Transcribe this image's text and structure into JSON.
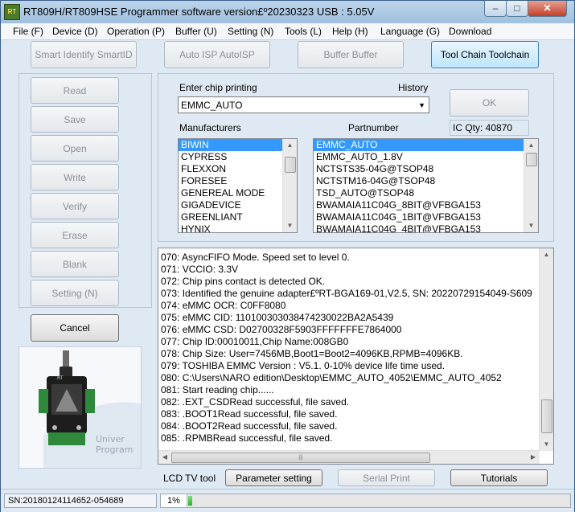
{
  "window": {
    "title": "RT809H/RT809HSE Programmer software version£º20230323  USB : 5.05V",
    "icon_text": "RT",
    "minimize": "–",
    "maximize": "□",
    "close": "✕"
  },
  "menu": [
    "File (F)",
    "Device (D)",
    "Operation (P)",
    "Buffer (U)",
    "Setting (N)",
    "Tools (L)",
    "Help (H)",
    "Language (G)",
    "Download"
  ],
  "toolbar": {
    "smart_identify": "Smart Identify SmartID",
    "auto_isp": "Auto ISP AutoISP",
    "buffer": "Buffer Buffer",
    "tool_chain": "Tool Chain Toolchain"
  },
  "operations": [
    "Read",
    "Save",
    "Open",
    "Write",
    "Verify",
    "Erase",
    "Blank",
    "Setting (N)"
  ],
  "cancel_label": "Cancel",
  "chip": {
    "enter_label": "Enter chip printing",
    "history_label": "History",
    "value": "EMMC_AUTO",
    "ok_label": "OK",
    "ic_qty": "IC Qty: 40870"
  },
  "manufacturers": {
    "label": "Manufacturers",
    "items": [
      "BIWIN",
      "CYPRESS",
      "FLEXXON",
      "FORESEE",
      "GENEREAL MODE",
      "GIGADEVICE",
      "GREENLIANT",
      "HYNIX"
    ]
  },
  "partnumbers": {
    "label": "Partnumber",
    "items": [
      "EMMC_AUTO",
      "EMMC_AUTO_1.8V",
      "NCTSTS35-04G@TSOP48",
      "NCTSTM16-04G@TSOP48",
      "TSD_AUTO@TSOP48",
      "BWAMAIA11C04G_8BIT@VFBGA153",
      "BWAMAIA11C04G_1BIT@VFBGA153",
      "BWAMAIA11C04G_4BIT@VFBGA153"
    ]
  },
  "log": [
    "070:  AsyncFIFO Mode. Speed set to level 0.",
    "071:  VCCIO: 3.3V",
    "072:  Chip pins contact is detected OK.",
    "073:  Identified the genuine adapter£ºRT-BGA169-01,V2.5, SN: 20220729154049-S609",
    "074:  eMMC OCR: C0FF8080",
    "075:  eMMC CID:  110100303038474230022BA2A5439",
    "076:  eMMC CSD: D02700328F5903FFFFFFFE7864000",
    "077:  Chip ID:00010011,Chip Name:008GB0",
    "078:  Chip Size: User=7456MB,Boot1=Boot2=4096KB,RPMB=4096KB.",
    "079:  TOSHIBA EMMC Version : V5.1.   0-10% device life time used.",
    "080:  C:\\Users\\NARO edition\\Desktop\\EMMC_AUTO_4052\\EMMC_AUTO_4052",
    "081:  Start reading chip......",
    "082:  .EXT_CSDRead successful, file saved.",
    "083:  .BOOT1Read successful, file saved.",
    "084:  .BOOT2Read successful, file saved.",
    "085:  .RPMBRead successful, file saved."
  ],
  "bottom": {
    "lcd_label": "LCD TV tool",
    "parameter_setting": "Parameter setting",
    "serial_print": "Serial Print",
    "tutorials": "Tutorials"
  },
  "status": {
    "sn": "SN:20180124114652-054689",
    "progress_text": "1%",
    "progress_value": 0.01
  },
  "adapter_image_text": [
    "RT",
    "Univer",
    "Program"
  ],
  "colors": {
    "selection": "#3399ff",
    "progress": "#1fb51f"
  }
}
